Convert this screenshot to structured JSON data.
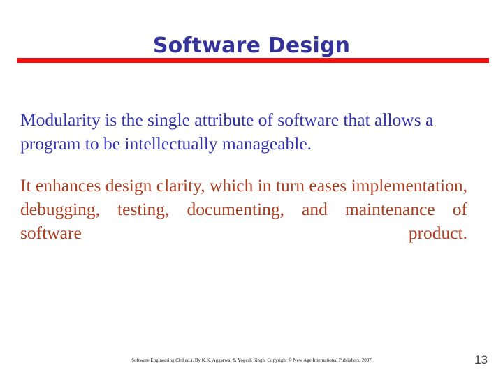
{
  "slide": {
    "title": "Software Design",
    "title_color": "#333399",
    "divider_color": "#ee1111",
    "background_color": "#ffffff",
    "paragraphs": [
      {
        "id": "modularity-definition",
        "text": "Modularity is the single attribute of software that allows a program to be intellectually manageable.",
        "color": "#3333aa",
        "align": "left"
      },
      {
        "id": "modularity-benefits",
        "text": "It enhances design clarity, which in turn eases implementation, debugging, testing, documenting, and maintenance of software product.",
        "color": "#aa3f22",
        "align": "justify"
      }
    ],
    "footer": {
      "citation": "Software Engineering (3rd ed.), By K.K. Aggarwal & Yogesh Singh, Copyright © New Age International Publishers, 2007",
      "page_number": "13"
    }
  }
}
